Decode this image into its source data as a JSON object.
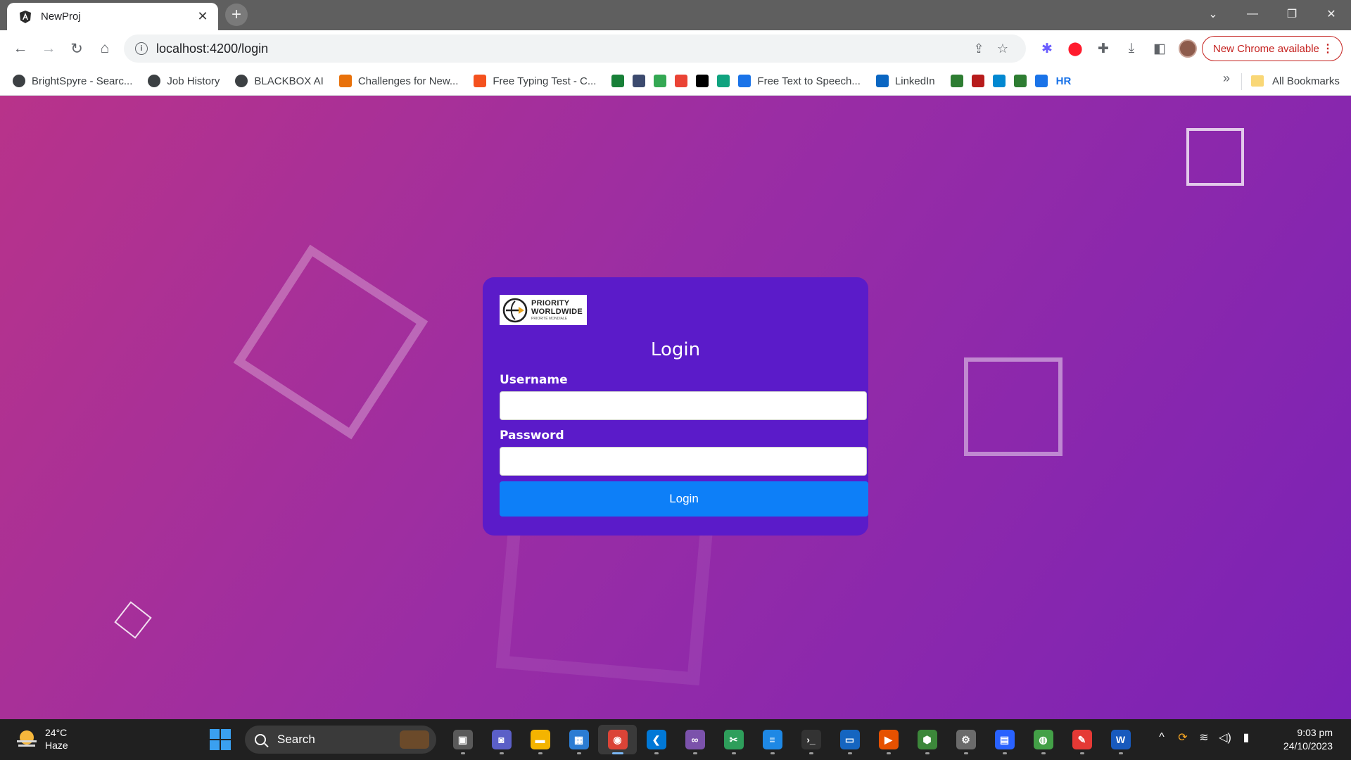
{
  "browser": {
    "tab_title": "NewProj",
    "tab_close": "✕",
    "new_tab": "+",
    "window_controls": [
      "⌄",
      "—",
      "❐",
      "✕"
    ],
    "url": "localhost:4200/login",
    "update_label": "New Chrome available",
    "update_menu": "⋮"
  },
  "bookmarks": {
    "items": [
      {
        "label": "BrightSpyre - Searc...",
        "icon": "globe-icon",
        "color": "#3c4043"
      },
      {
        "label": "Job History",
        "icon": "globe-icon",
        "color": "#3c4043"
      },
      {
        "label": "BLACKBOX AI",
        "icon": "globe-icon",
        "color": "#3c4043"
      },
      {
        "label": "Challenges for New...",
        "icon": "leaf-icon",
        "color": "#e8710a"
      },
      {
        "label": "Free Typing Test - C...",
        "icon": "chat-icon",
        "color": "#f4511e"
      }
    ],
    "icon_only": [
      {
        "icon": "bank-icon",
        "color": "#188038"
      },
      {
        "icon": "building-icon",
        "color": "#3c4a6e"
      },
      {
        "icon": "drive-icon",
        "color": "#34a853"
      },
      {
        "icon": "gmail-icon",
        "color": "#ea4335"
      },
      {
        "icon": "x-icon",
        "color": "#000000"
      },
      {
        "icon": "chatgpt-icon",
        "color": "#10a37f"
      }
    ],
    "items2": [
      {
        "label": "Free Text to Speech...",
        "icon": "n-icon",
        "color": "#1a73e8"
      },
      {
        "label": "LinkedIn",
        "icon": "linkedin-icon",
        "color": "#0a66c2"
      }
    ],
    "icon_only2": [
      {
        "icon": "emblem-icon",
        "color": "#2e7d32"
      },
      {
        "icon": "scale-icon",
        "color": "#b71c1c"
      },
      {
        "icon": "wave-icon",
        "color": "#0288d1"
      },
      {
        "icon": "tree-icon",
        "color": "#2e7d32"
      },
      {
        "icon": "diamond-icon",
        "color": "#1a73e8"
      }
    ],
    "hr_label": "HR",
    "more": "»",
    "all_bookmarks": "All Bookmarks"
  },
  "login": {
    "logo_line1": "PRIORITY",
    "logo_line2": "WORLDWIDE",
    "logo_line3": "PRIORITÉ MONDIALE",
    "title": "Login",
    "username_label": "Username",
    "username_value": "",
    "password_label": "Password",
    "password_value": "",
    "submit_label": "Login",
    "colors": {
      "card": "#5b1bc9",
      "button": "#0d7ff8",
      "bg_start": "#b8338a",
      "bg_end": "#7a22b6"
    }
  },
  "taskbar": {
    "temperature": "24°C",
    "condition": "Haze",
    "search_placeholder": "Search",
    "apps": [
      {
        "name": "task-view-icon",
        "color": "#5a5a5a",
        "glyph": "▣"
      },
      {
        "name": "teams-meet-icon",
        "color": "#5b5fc7",
        "glyph": "◙"
      },
      {
        "name": "file-explorer-icon",
        "color": "#f4b400",
        "glyph": "▬"
      },
      {
        "name": "microsoft-store-icon",
        "color": "#2b7cd3",
        "glyph": "▦"
      },
      {
        "name": "chrome-icon",
        "color": "#db4437",
        "glyph": "◉",
        "active": true
      },
      {
        "name": "vscode-icon",
        "color": "#0078d7",
        "glyph": "❮"
      },
      {
        "name": "visual-studio-icon",
        "color": "#7b52ab",
        "glyph": "∞"
      },
      {
        "name": "snipping-icon",
        "color": "#2e9e5b",
        "glyph": "✂"
      },
      {
        "name": "notepad-icon",
        "color": "#1e88e5",
        "glyph": "≡"
      },
      {
        "name": "terminal-icon",
        "color": "#333333",
        "glyph": "›_"
      },
      {
        "name": "remote-desktop-icon",
        "color": "#1565c0",
        "glyph": "▭"
      },
      {
        "name": "media-player-icon",
        "color": "#e65100",
        "glyph": "▶"
      },
      {
        "name": "nodejs-icon",
        "color": "#3c873a",
        "glyph": "⬢"
      },
      {
        "name": "settings-icon",
        "color": "#6b6b6b",
        "glyph": "⚙"
      },
      {
        "name": "ssms-icon",
        "color": "#2962ff",
        "glyph": "▤"
      },
      {
        "name": "globe-app-icon",
        "color": "#43a047",
        "glyph": "◍"
      },
      {
        "name": "paint-icon",
        "color": "#e53935",
        "glyph": "✎"
      },
      {
        "name": "word-icon",
        "color": "#185abd",
        "glyph": "W"
      }
    ],
    "tray_icons": [
      "^",
      "⟳",
      "≋",
      "◁)",
      "▮"
    ],
    "time": "9:03 pm",
    "date": "24/10/2023"
  }
}
